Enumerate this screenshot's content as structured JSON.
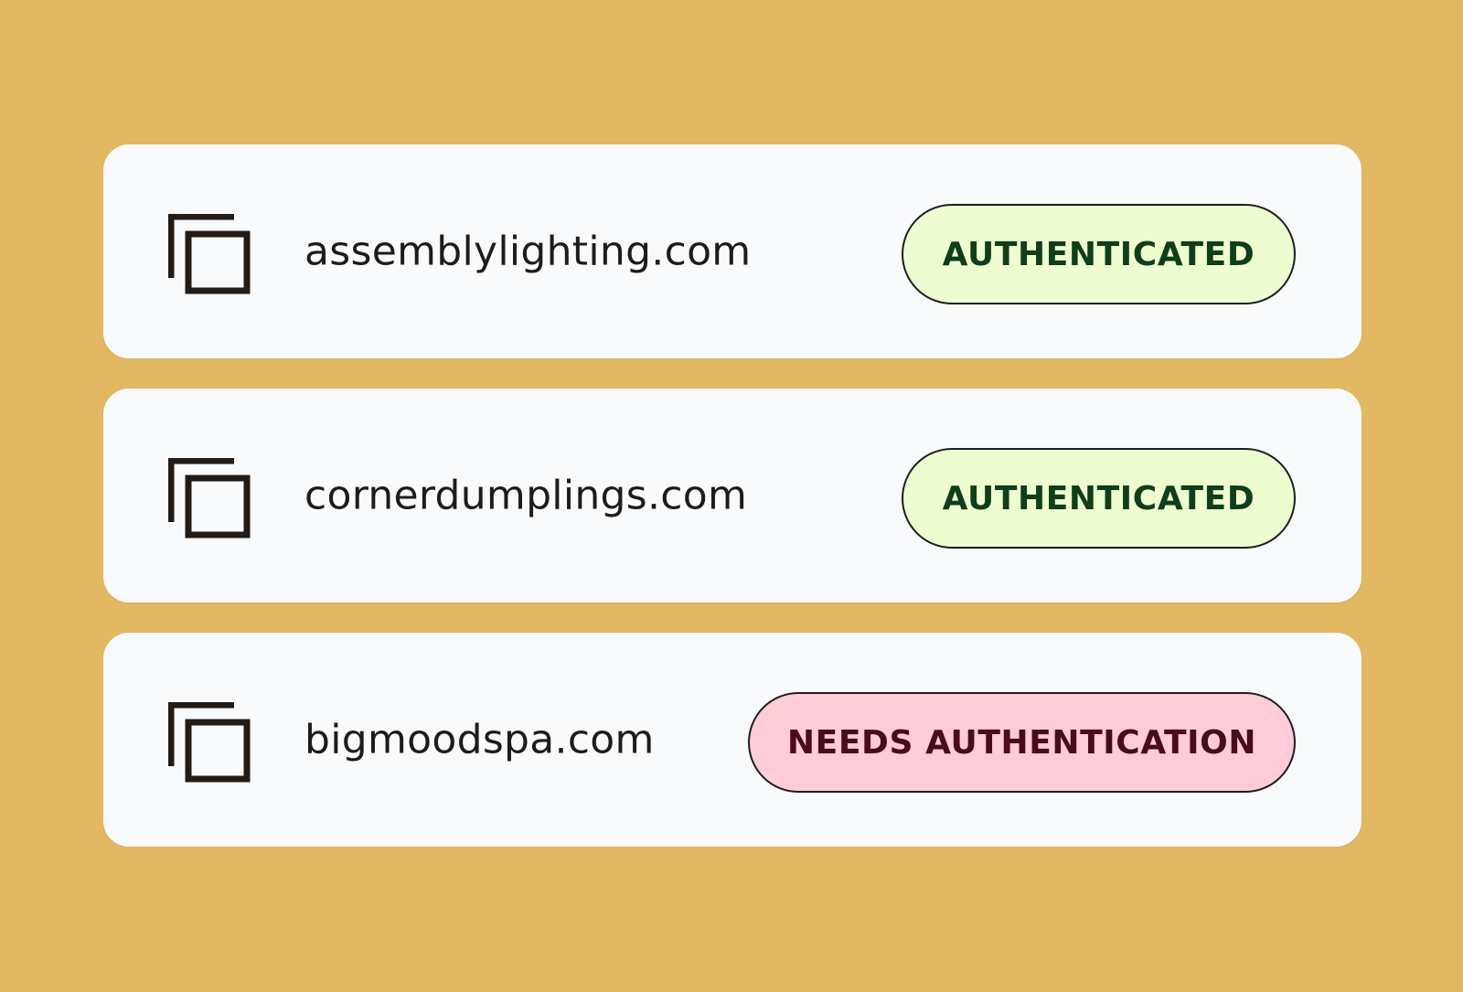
{
  "domains": [
    {
      "name": "assemblylighting.com",
      "icon": "copy-icon",
      "status": "AUTHENTICATED",
      "status_kind": "ok"
    },
    {
      "name": "cornerdumplings.com",
      "icon": "copy-icon",
      "status": "AUTHENTICATED",
      "status_kind": "ok"
    },
    {
      "name": "bigmoodspa.com",
      "icon": "copy-icon",
      "status": "NEEDS AUTHENTICATION",
      "status_kind": "warn"
    }
  ],
  "colors": {
    "background": "#E3B862",
    "card": "#F9FAFC",
    "ok_badge_bg": "#EEFDCF",
    "ok_badge_text": "#103D1A",
    "warn_badge_bg": "#FFCCD8",
    "warn_badge_text": "#4A0B1D",
    "icon": "#231B16"
  }
}
